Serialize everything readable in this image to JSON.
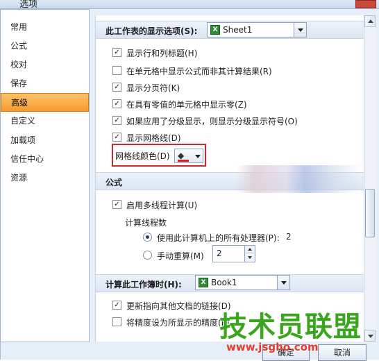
{
  "window": {
    "title": "选项"
  },
  "nav": {
    "items": [
      {
        "label": "常用",
        "selected": false
      },
      {
        "label": "公式",
        "selected": false
      },
      {
        "label": "校对",
        "selected": false
      },
      {
        "label": "保存",
        "selected": false
      },
      {
        "label": "高级",
        "selected": true
      },
      {
        "label": "自定义",
        "selected": false
      },
      {
        "label": "加载项",
        "selected": false
      },
      {
        "label": "信任中心",
        "selected": false
      },
      {
        "label": "资源",
        "selected": false
      }
    ]
  },
  "worksheet_section": {
    "label": "此工作表的显示选项(S):",
    "sheet_combo": {
      "value": "Sheet1"
    },
    "options": [
      {
        "label": "显示行和列标题(H)",
        "checked": true
      },
      {
        "label": "在单元格中显示公式而非其计算结果(R)",
        "checked": false
      },
      {
        "label": "显示分页符(K)",
        "checked": true
      },
      {
        "label": "在具有零值的单元格中显示零(Z)",
        "checked": true
      },
      {
        "label": "如果应用了分级显示，则显示分级显示符号(O)",
        "checked": true
      },
      {
        "label": "显示网格线(D)",
        "checked": true
      }
    ],
    "gridline_color_label": "网格线颜色(D)",
    "gridline_color": "#d81b24"
  },
  "formula_section": {
    "label": "公式",
    "multithread": {
      "label": "启用多线程计算(U)",
      "checked": true
    },
    "threads_label": "计算线程数",
    "use_all_processors": {
      "label": "使用此计算机上的所有处理器(P):",
      "count": "2",
      "selected": true
    },
    "manual": {
      "label": "手动重算(M)",
      "value": "2",
      "selected": false
    }
  },
  "workbook_section": {
    "label": "计算此工作簿时(H):",
    "book_combo": {
      "value": "Book1"
    },
    "options": [
      {
        "label": "更新指向其他文档的链接(D)",
        "checked": true
      },
      {
        "label": "将精度设为所显示的精度(P)",
        "checked": false
      }
    ]
  },
  "buttons": {
    "ok": "确定",
    "cancel": "取消"
  },
  "watermark": {
    "text": "技术员联盟",
    "url": "www.jsgho.com"
  },
  "colors": {
    "accent": "#f79a2f",
    "header_bg": "#dbe5f2",
    "watermark_green": "#3aa61f",
    "watermark_red": "#e63b2e"
  }
}
